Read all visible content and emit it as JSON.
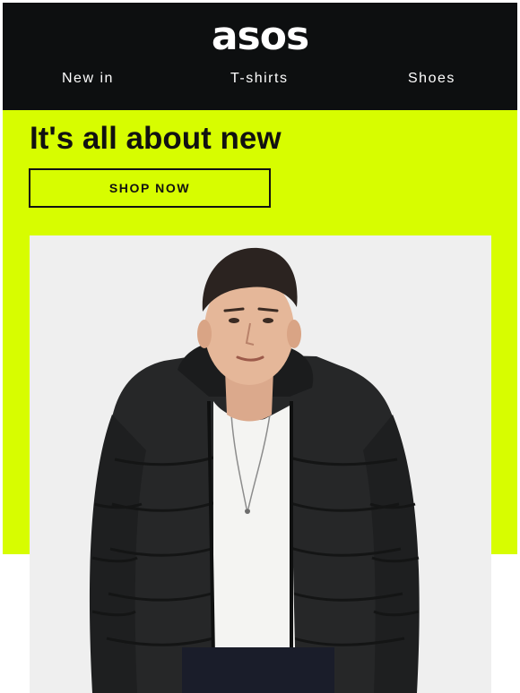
{
  "brand": {
    "logo_text": "asos"
  },
  "nav": {
    "items": [
      {
        "label": "New in"
      },
      {
        "label": "T-shirts"
      },
      {
        "label": "Shoes"
      }
    ]
  },
  "hero": {
    "headline": "It's all about new",
    "cta_label": "SHOP NOW"
  },
  "colors": {
    "header_bg": "#0d0f10",
    "accent_lime": "#d7fd00",
    "text_dark": "#111111",
    "photo_bg": "#efefef"
  },
  "product_image": {
    "icon": "man-in-black-puffer-jacket-photo"
  }
}
